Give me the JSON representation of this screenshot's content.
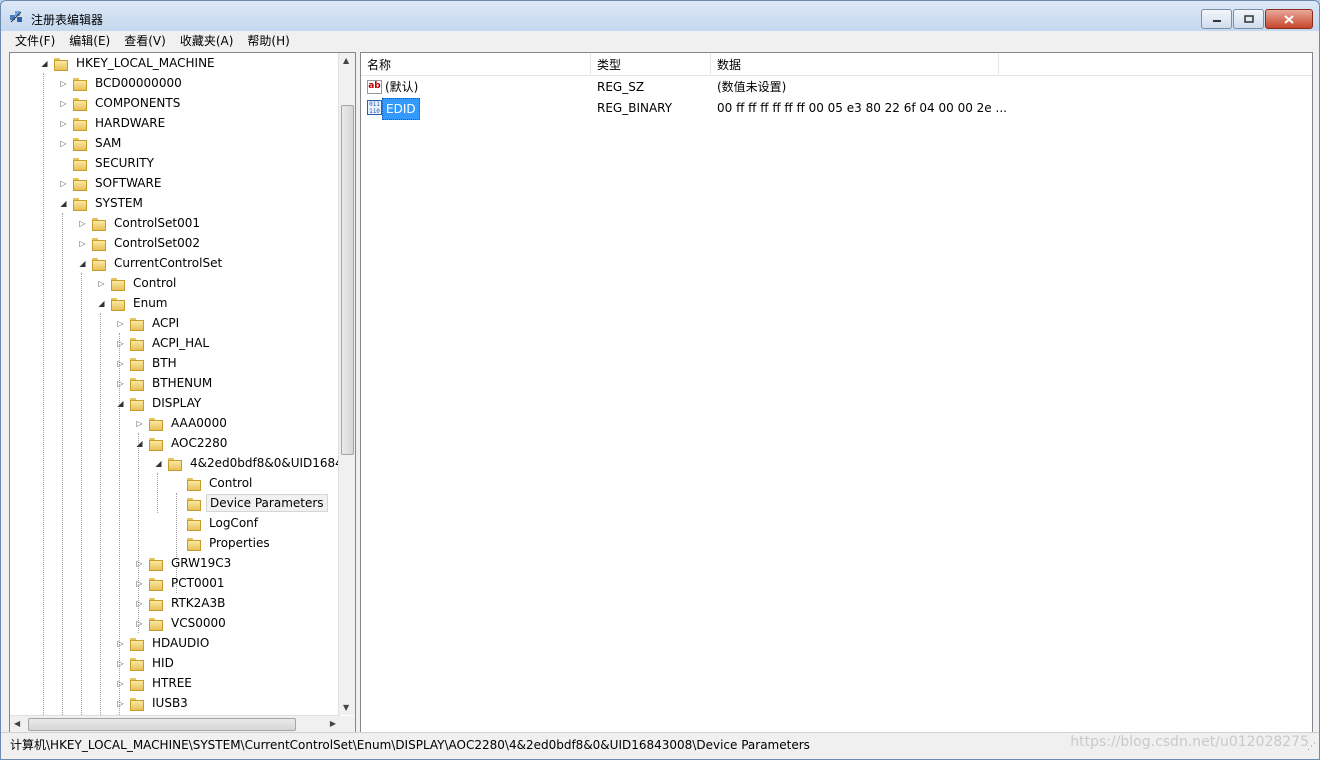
{
  "window": {
    "title": "注册表编辑器"
  },
  "menu": [
    "文件(F)",
    "编辑(E)",
    "查看(V)",
    "收藏夹(A)",
    "帮助(H)"
  ],
  "tree": [
    {
      "label": "HKEY_LOCAL_MACHINE",
      "level": 0,
      "expander": "open"
    },
    {
      "label": "BCD00000000",
      "level": 1,
      "expander": "closed"
    },
    {
      "label": "COMPONENTS",
      "level": 1,
      "expander": "closed"
    },
    {
      "label": "HARDWARE",
      "level": 1,
      "expander": "closed"
    },
    {
      "label": "SAM",
      "level": 1,
      "expander": "closed"
    },
    {
      "label": "SECURITY",
      "level": 1,
      "expander": "none"
    },
    {
      "label": "SOFTWARE",
      "level": 1,
      "expander": "closed"
    },
    {
      "label": "SYSTEM",
      "level": 1,
      "expander": "open"
    },
    {
      "label": "ControlSet001",
      "level": 2,
      "expander": "closed"
    },
    {
      "label": "ControlSet002",
      "level": 2,
      "expander": "closed"
    },
    {
      "label": "CurrentControlSet",
      "level": 2,
      "expander": "open"
    },
    {
      "label": "Control",
      "level": 3,
      "expander": "closed"
    },
    {
      "label": "Enum",
      "level": 3,
      "expander": "open"
    },
    {
      "label": "ACPI",
      "level": 4,
      "expander": "closed"
    },
    {
      "label": "ACPI_HAL",
      "level": 4,
      "expander": "closed"
    },
    {
      "label": "BTH",
      "level": 4,
      "expander": "closed"
    },
    {
      "label": "BTHENUM",
      "level": 4,
      "expander": "closed"
    },
    {
      "label": "DISPLAY",
      "level": 4,
      "expander": "open"
    },
    {
      "label": "AAA0000",
      "level": 5,
      "expander": "closed"
    },
    {
      "label": "AOC2280",
      "level": 5,
      "expander": "open"
    },
    {
      "label": "4&2ed0bdf8&0&UID1684",
      "level": 6,
      "expander": "open"
    },
    {
      "label": "Control",
      "level": 7,
      "expander": "none"
    },
    {
      "label": "Device Parameters",
      "level": 7,
      "expander": "none",
      "selected": true
    },
    {
      "label": "LogConf",
      "level": 7,
      "expander": "none"
    },
    {
      "label": "Properties",
      "level": 7,
      "expander": "none"
    },
    {
      "label": "GRW19C3",
      "level": 5,
      "expander": "closed"
    },
    {
      "label": "PCT0001",
      "level": 5,
      "expander": "closed"
    },
    {
      "label": "RTK2A3B",
      "level": 5,
      "expander": "closed"
    },
    {
      "label": "VCS0000",
      "level": 5,
      "expander": "closed"
    },
    {
      "label": "HDAUDIO",
      "level": 4,
      "expander": "closed"
    },
    {
      "label": "HID",
      "level": 4,
      "expander": "closed"
    },
    {
      "label": "HTREE",
      "level": 4,
      "expander": "closed"
    },
    {
      "label": "IUSB3",
      "level": 4,
      "expander": "closed"
    }
  ],
  "list": {
    "columns": [
      "名称",
      "类型",
      "数据"
    ],
    "rows": [
      {
        "icon": "string-value-icon",
        "icon_text": "ab",
        "name": "(默认)",
        "type": "REG_SZ",
        "data": "(数值未设置)"
      },
      {
        "icon": "binary-value-icon",
        "icon_text": "011 110",
        "name": "EDID",
        "type": "REG_BINARY",
        "data": "00 ff ff ff ff ff ff 00 05 e3 80 22 6f 04 00 00 2e ...",
        "selected": true
      }
    ]
  },
  "status": {
    "path": "计算机\\HKEY_LOCAL_MACHINE\\SYSTEM\\CurrentControlSet\\Enum\\DISPLAY\\AOC2280\\4&2ed0bdf8&0&UID16843008\\Device Parameters",
    "watermark": "https://blog.csdn.net/u012028275"
  }
}
